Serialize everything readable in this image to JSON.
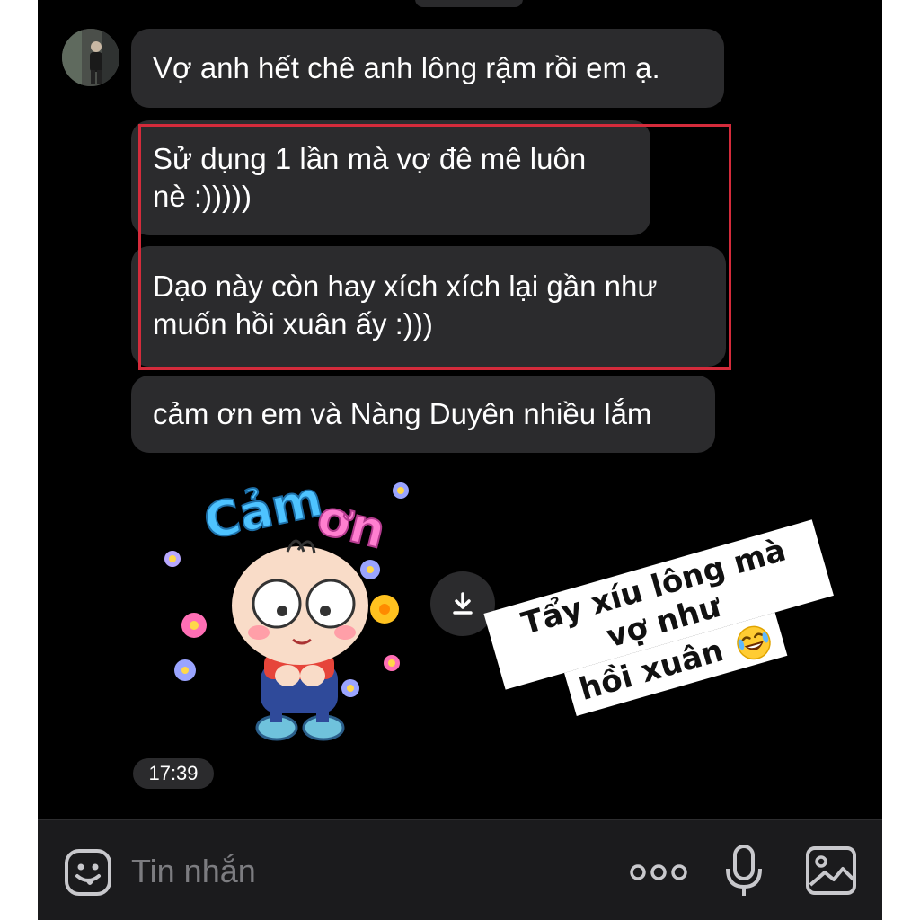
{
  "chat": {
    "messages": [
      {
        "text": "Vợ anh hết chê anh lông rậm rồi em ạ."
      },
      {
        "line1": "Sử dụng 1 lần mà vợ đê mê luôn",
        "line2": "nè :)))))"
      },
      {
        "line1": "Dạo này còn hay xích xích lại gần như",
        "line2": "muốn hồi xuân ấy :)))"
      },
      {
        "text": "cảm ơn em và Nàng Duyên nhiều lắm"
      }
    ],
    "sticker": {
      "text": "Cảm ơn"
    },
    "timestamp": "17:39"
  },
  "overlay": {
    "caption_line1": "Tẩy xíu lông mà vợ như",
    "caption_line2": "hồi xuân",
    "highlight_color": "#d42b3b"
  },
  "composer": {
    "placeholder": "Tin nhắn",
    "icons": [
      "emoji-icon",
      "more-icon",
      "microphone-icon",
      "image-icon"
    ]
  },
  "colors": {
    "background": "#000000",
    "bubble": "#2b2b2d",
    "composer": "#1b1b1d",
    "text": "#ffffff"
  }
}
